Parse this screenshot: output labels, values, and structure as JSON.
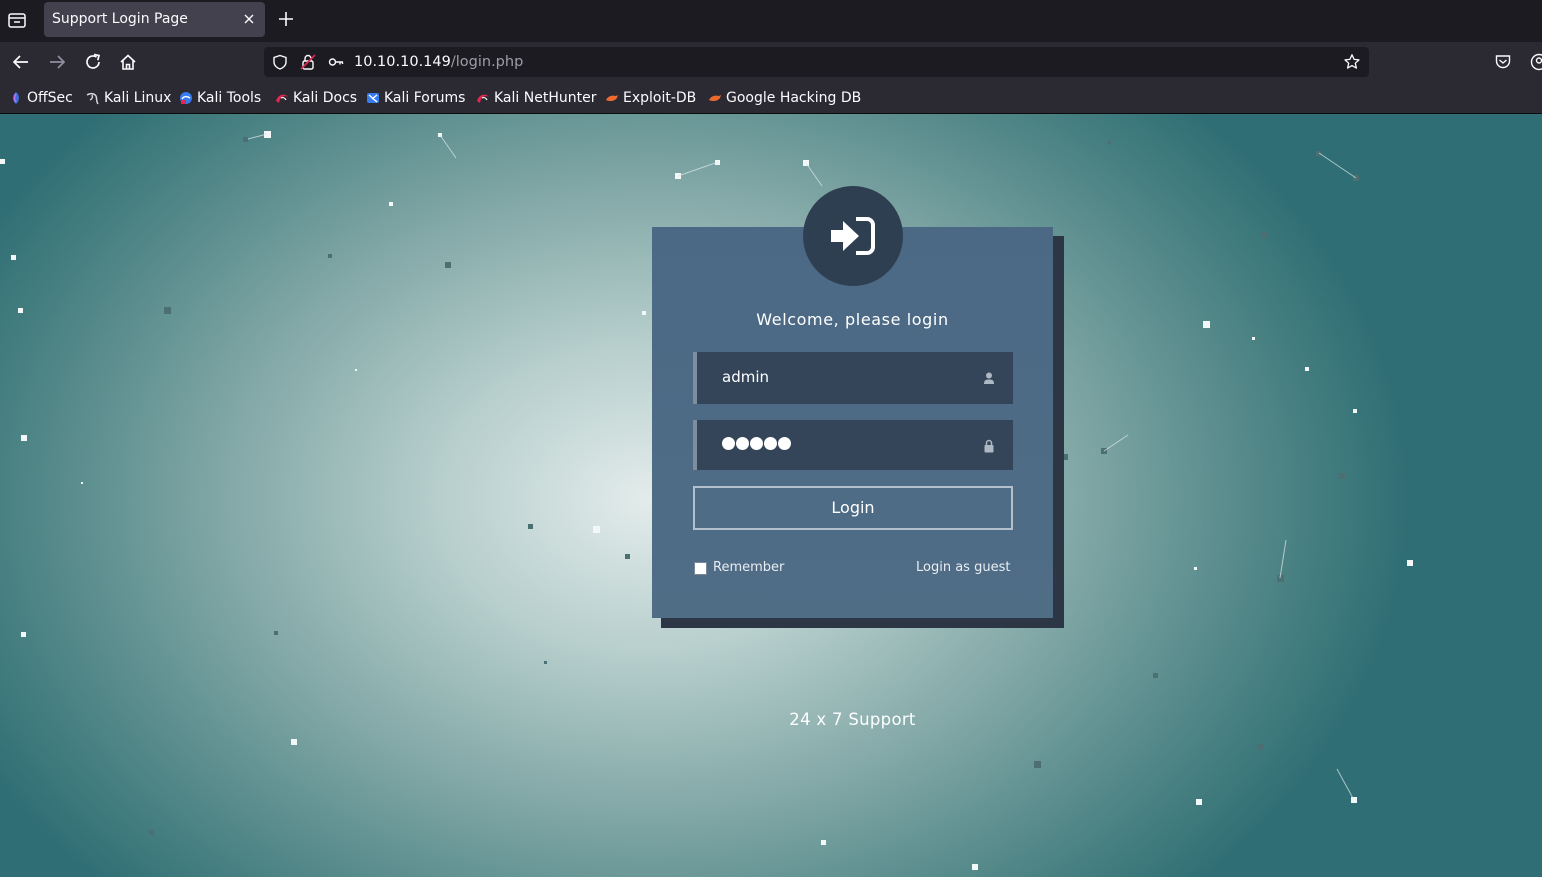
{
  "browser": {
    "tab": {
      "title": "Support Login Page"
    },
    "url": {
      "host": "10.10.10.149",
      "path": "/login.php"
    },
    "bookmarks": [
      {
        "label": "OffSec",
        "icon": "offsec-icon"
      },
      {
        "label": "Kali Linux",
        "icon": "kali-dragon-icon"
      },
      {
        "label": "Kali Tools",
        "icon": "kali-tools-icon"
      },
      {
        "label": "Kali Docs",
        "icon": "kali-docs-icon"
      },
      {
        "label": "Kali Forums",
        "icon": "kali-forums-icon"
      },
      {
        "label": "Kali NetHunter",
        "icon": "kali-nethunter-icon"
      },
      {
        "label": "Exploit-DB",
        "icon": "exploit-db-icon"
      },
      {
        "label": "Google Hacking DB",
        "icon": "google-hacking-db-icon"
      }
    ]
  },
  "login": {
    "icon": "sign-in-icon",
    "heading": "Welcome, please login",
    "username_value": "admin",
    "username_icon": "user-icon",
    "password_mask_length": 5,
    "password_icon": "lock-icon",
    "submit_label": "Login",
    "remember_label": "Remember",
    "remember_checked": false,
    "guest_label": "Login as guest"
  },
  "footer": {
    "support_text": "24 x 7 Support"
  },
  "colors": {
    "card": "#4b6985",
    "field": "#34455a",
    "avatar": "#2f3f52",
    "browser_chrome": "#2b2a33"
  }
}
